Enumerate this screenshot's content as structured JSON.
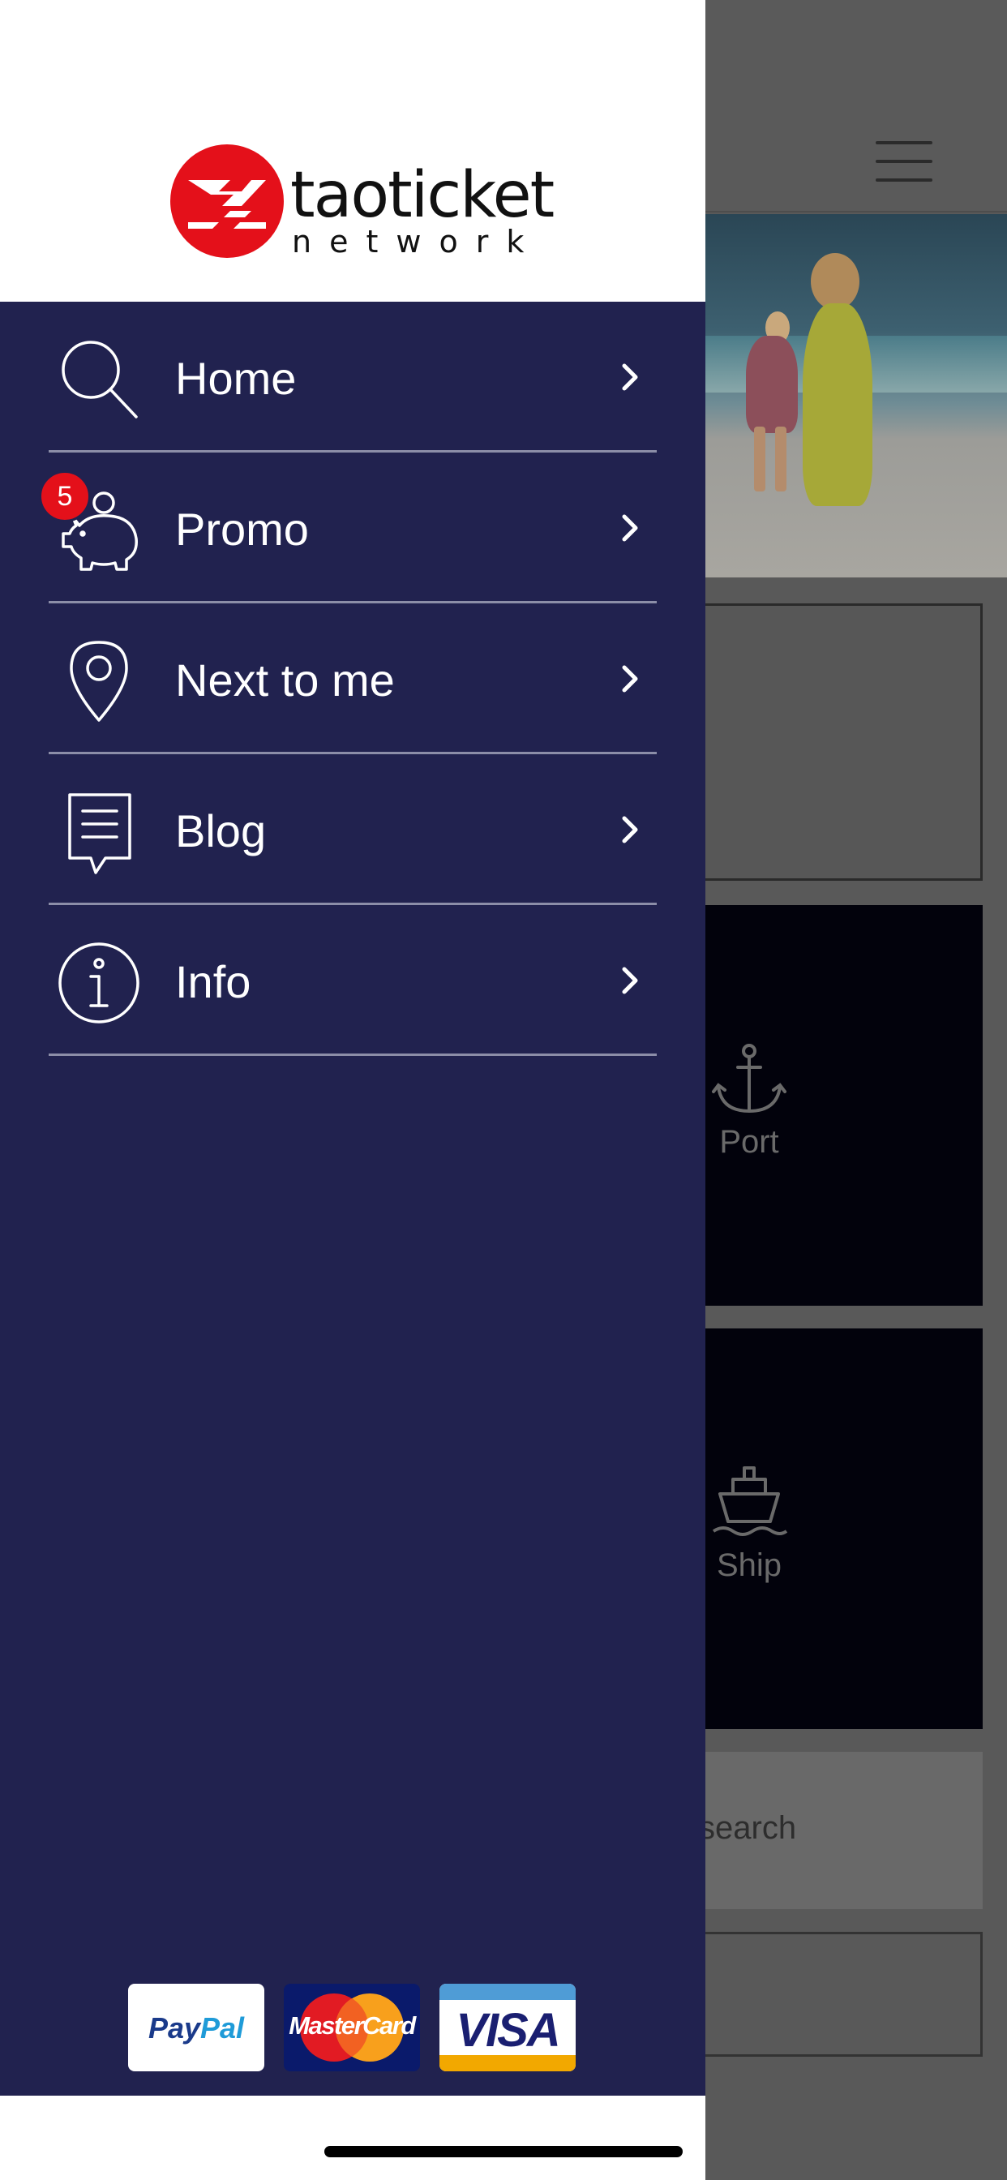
{
  "background": {
    "tiles": [
      {
        "label": "Port",
        "icon": "anchor-icon"
      },
      {
        "label": "Ship",
        "icon": "ship-icon"
      }
    ],
    "search_text": "search",
    "hero_next_icon": "chevron-right-icon"
  },
  "drawer": {
    "logo": {
      "name": "taoticket",
      "subtitle": "network"
    },
    "menu": [
      {
        "label": "Home",
        "icon": "search-icon"
      },
      {
        "label": "Promo",
        "icon": "piggy-bank-icon",
        "badge": "5"
      },
      {
        "label": "Next to me",
        "icon": "location-pin-icon"
      },
      {
        "label": "Blog",
        "icon": "blog-note-icon"
      },
      {
        "label": "Info",
        "icon": "info-icon"
      }
    ],
    "payments": [
      {
        "name": "PayPal"
      },
      {
        "name": "MasterCard"
      },
      {
        "name": "VISA"
      }
    ]
  },
  "colors": {
    "drawer_bg": "#21224f",
    "badge": "#e4101a",
    "logo_red": "#e4101a",
    "overlay_bg": "#595959"
  }
}
